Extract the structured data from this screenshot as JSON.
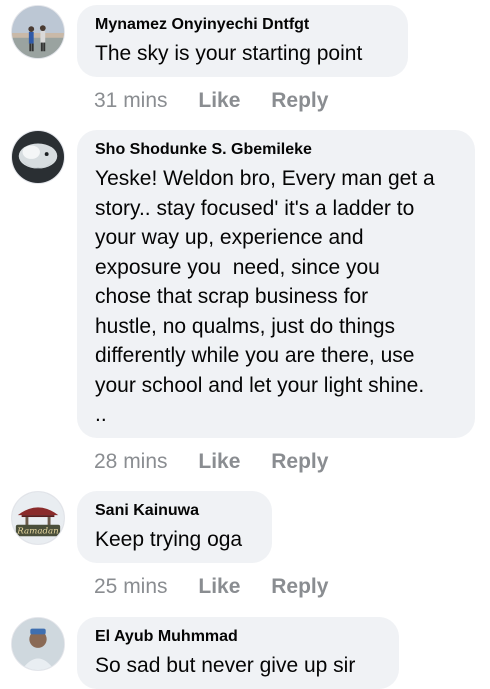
{
  "comments": [
    {
      "author": "Mynamez Onyinyechi Dntfgt",
      "text": "The sky is your starting point",
      "time": "31 mins",
      "like_label": "Like",
      "reply_label": "Reply"
    },
    {
      "author": "Sho Shodunke S. Gbemileke",
      "text_lines": [
        "Yeske! Weldon bro, Every man get a",
        "story.. stay focused' it's a ladder to",
        "your way up, experience and",
        "exposure you  need, since you",
        "chose that scrap business for",
        "hustle, no qualms, just do things",
        "differently while you are there, use",
        "your school and let your light shine.",
        ".."
      ],
      "time": "28 mins",
      "like_label": "Like",
      "reply_label": "Reply"
    },
    {
      "author": "Sani Kainuwa",
      "text": "Keep trying oga",
      "time": "25 mins",
      "like_label": "Like",
      "reply_label": "Reply",
      "avatar_text": "Ramadan"
    },
    {
      "author": "El Ayub Muhmmad",
      "text": "So sad but never give up sir"
    }
  ]
}
